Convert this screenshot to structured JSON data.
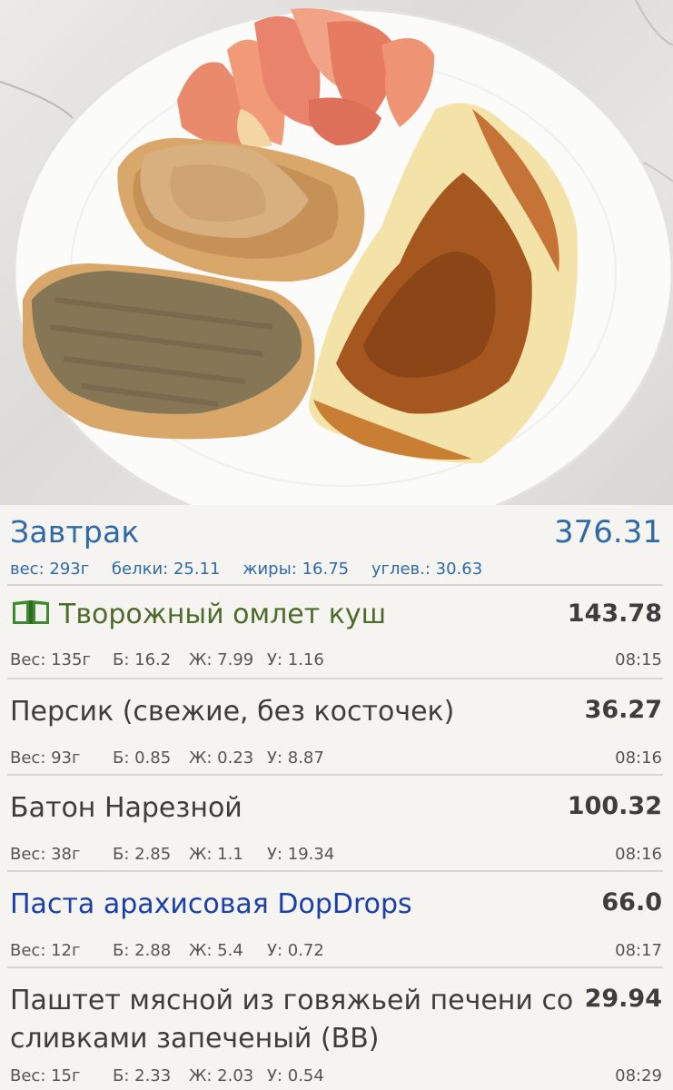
{
  "meal": {
    "title": "Завтрак",
    "total": "376.31",
    "stats": {
      "weight": "вес: 293г",
      "protein": "белки: 25.11",
      "fat": "жиры: 16.75",
      "carbs": "углев.: 30.63"
    }
  },
  "entries": [
    {
      "name": "Творожный омлет куш",
      "name_color": "#4d6b2c",
      "icon": "recipe-book-icon",
      "kcal": "143.78",
      "weight": "Вес: 135г",
      "protein": "Б: 16.2",
      "fat": "Ж: 7.99",
      "carbs": "У: 1.16",
      "time": "08:15"
    },
    {
      "name": "Персик (свежие, без косточек)",
      "kcal": "36.27",
      "weight": "Вес: 93г",
      "protein": "Б: 0.85",
      "fat": "Ж: 0.23",
      "carbs": "У: 8.87",
      "time": "08:16"
    },
    {
      "name": "Батон Нарезной",
      "kcal": "100.32",
      "weight": "Вес: 38г",
      "protein": "Б: 2.85",
      "fat": "Ж: 1.1",
      "carbs": "У: 19.34",
      "time": "08:16"
    },
    {
      "name": "Паста арахисовая DopDrops",
      "name_color": "#1b3fa8",
      "kcal": "66.0",
      "weight": "Вес: 12г",
      "protein": "Б: 2.88",
      "fat": "Ж: 5.4",
      "carbs": "У: 0.72",
      "time": "08:17"
    },
    {
      "name_line1": "Паштет мясной из говяжьей печени со",
      "name_line2": "сливками запеченый (ВВ)",
      "kcal": "29.94",
      "weight": "Вес: 15г",
      "protein": "Б: 2.33",
      "fat": "Ж: 2.03",
      "carbs": "У: 0.54",
      "time": "08:29"
    }
  ],
  "colors": {
    "accent": "#2f6aa6",
    "text": "#3d3d3d",
    "recipe_green": "#4d6b2c",
    "link_blue": "#1b3fa8"
  }
}
